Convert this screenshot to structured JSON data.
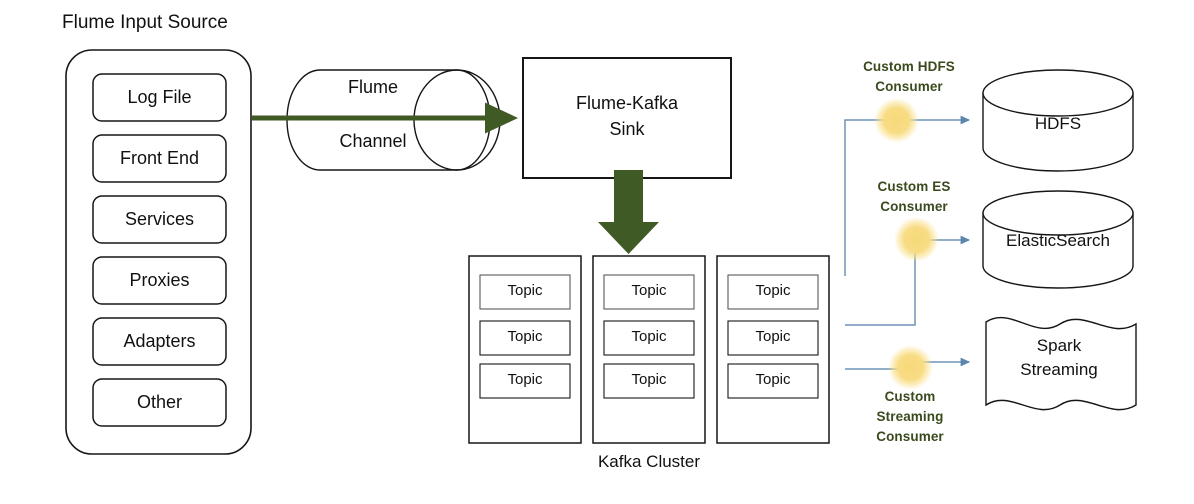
{
  "diagram": {
    "title": "Flume Input Source",
    "kafka_cluster_label": "Kafka Cluster",
    "topic_label": "Topic"
  },
  "input_sources": [
    {
      "label": "Log File"
    },
    {
      "label": "Front End"
    },
    {
      "label": "Services"
    },
    {
      "label": "Proxies"
    },
    {
      "label": "Adapters"
    },
    {
      "label": "Other"
    }
  ],
  "channel": {
    "line1": "Flume",
    "line2": "Channel"
  },
  "sink": {
    "line1": "Flume-Kafka",
    "line2": "Sink"
  },
  "kafka": {
    "brokers": [
      {
        "topics": [
          "Topic",
          "Topic",
          "Topic"
        ]
      },
      {
        "topics": [
          "Topic",
          "Topic",
          "Topic"
        ]
      },
      {
        "topics": [
          "Topic",
          "Topic",
          "Topic"
        ]
      }
    ]
  },
  "consumers": [
    {
      "id": "hdfs",
      "lines": [
        "Custom HDFS",
        "Consumer"
      ]
    },
    {
      "id": "es",
      "lines": [
        "Custom ES",
        "Consumer"
      ]
    },
    {
      "id": "streaming",
      "lines": [
        "Custom",
        "Streaming",
        "Consumer"
      ]
    }
  ],
  "sinks": [
    {
      "id": "hdfs",
      "label": "HDFS",
      "shape": "cylinder"
    },
    {
      "id": "elasticsearch",
      "label": "ElasticSearch",
      "shape": "cylinder"
    },
    {
      "id": "spark",
      "label": "Spark\nStreaming",
      "shape": "wave",
      "line1": "Spark",
      "line2": "Streaming"
    }
  ],
  "colors": {
    "flow_green": "#3f5a24",
    "consumer_text": "#3a4a1e",
    "connector_blue": "#6f93b5",
    "marker_yellow": "#f6d978",
    "outline": "#161616",
    "background": "#ffffff"
  }
}
